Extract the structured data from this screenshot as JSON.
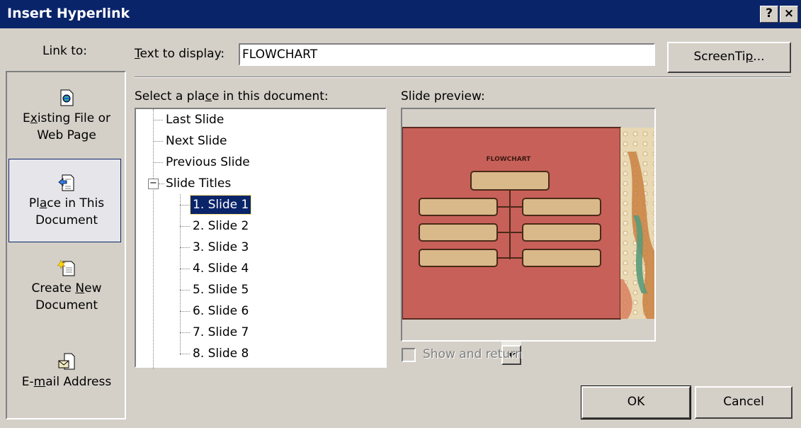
{
  "window": {
    "title": "Insert Hyperlink",
    "help_glyph": "?",
    "close_glyph": "×"
  },
  "link_to": {
    "label": "Link to:",
    "items": [
      {
        "line1_pre": "E",
        "line1_ul": "x",
        "line1_post": "isting File or",
        "line2": "Web Page",
        "icon": "web-file-icon"
      },
      {
        "line1_pre": "Pl",
        "line1_ul": "a",
        "line1_post": "ce in This",
        "line2": "Document",
        "icon": "place-document-icon"
      },
      {
        "line1_pre": "Create ",
        "line1_ul": "N",
        "line1_post": "ew",
        "line2": "Document",
        "icon": "new-document-icon"
      },
      {
        "line1_pre": "E-",
        "line1_ul": "m",
        "line1_post": "ail Address",
        "line2": "",
        "icon": "email-icon"
      }
    ]
  },
  "text_to_display": {
    "label_ul": "T",
    "label_rest": "ext to display:",
    "value": "FLOWCHART"
  },
  "screentip_button": {
    "pre": "ScreenTi",
    "ul": "p",
    "post": "..."
  },
  "select_place": {
    "label_pre": "Select a pla",
    "label_ul": "c",
    "label_post": "e in this document:"
  },
  "tree": {
    "top_items": [
      "Last Slide",
      "Next Slide",
      "Previous Slide"
    ],
    "group_label": "Slide Titles",
    "expander": "−",
    "slides": [
      "1. Slide 1",
      "2. Slide 2",
      "3. Slide 3",
      "4. Slide 4",
      "5. Slide 5",
      "6. Slide 6",
      "7. Slide 7",
      "8. Slide 8"
    ],
    "selected_index": 0
  },
  "slide_preview": {
    "label": "Slide preview:",
    "slide_title": "FLOWCHART"
  },
  "show_and_return": {
    "label": "Show and return",
    "checked": false,
    "enabled": false
  },
  "buttons": {
    "ok": "OK",
    "cancel": "Cancel"
  },
  "colors": {
    "titlebar": "#0a246a",
    "selection": "#0a246a",
    "slide_bg": "#c8605a",
    "box_fill": "#d9b88a"
  }
}
